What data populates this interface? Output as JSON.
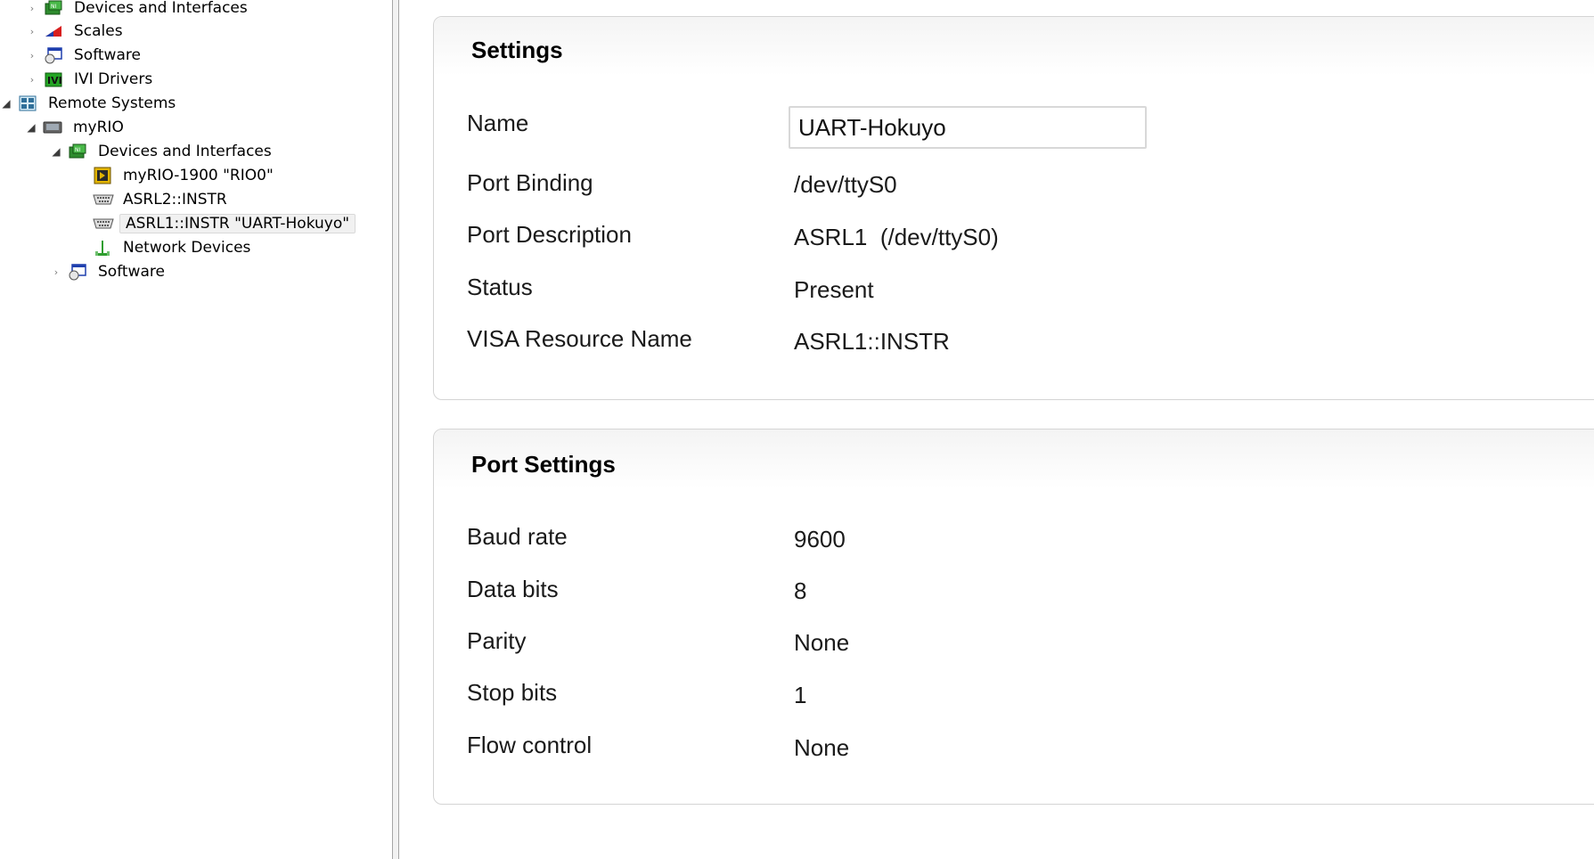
{
  "tree": {
    "items": [
      {
        "label": "Devices and Interfaces",
        "icon": "devices-interfaces-icon",
        "expander": "collapsed"
      },
      {
        "label": "Scales",
        "icon": "scales-icon",
        "expander": "collapsed"
      },
      {
        "label": "Software",
        "icon": "software-icon",
        "expander": "collapsed"
      },
      {
        "label": "IVI Drivers",
        "icon": "ivi-drivers-icon",
        "expander": "collapsed"
      },
      {
        "label": "Remote Systems",
        "icon": "remote-systems-icon",
        "expander": "expanded"
      },
      {
        "label": "myRIO",
        "icon": "computer-icon",
        "expander": "expanded"
      },
      {
        "label": "Devices and Interfaces",
        "icon": "devices-interfaces-icon",
        "expander": "expanded"
      },
      {
        "label": "myRIO-1900 \"RIO0\"",
        "icon": "daq-device-icon",
        "expander": "none"
      },
      {
        "label": "ASRL2::INSTR",
        "icon": "serial-port-icon",
        "expander": "none"
      },
      {
        "label": "ASRL1::INSTR \"UART-Hokuyo\"",
        "icon": "serial-port-icon",
        "expander": "none",
        "selected": true
      },
      {
        "label": "Network Devices",
        "icon": "network-devices-icon",
        "expander": "none"
      },
      {
        "label": "Software",
        "icon": "software-icon",
        "expander": "collapsed"
      }
    ]
  },
  "settings": {
    "title": "Settings",
    "name_label": "Name",
    "name_value": "UART-Hokuyo",
    "port_binding_label": "Port Binding",
    "port_binding_value": "/dev/ttyS0",
    "port_description_label": "Port Description",
    "port_description_value": "ASRL1  (/dev/ttyS0)",
    "status_label": "Status",
    "status_value": "Present",
    "visa_label": "VISA Resource Name",
    "visa_value": "ASRL1::INSTR"
  },
  "port_settings": {
    "title": "Port Settings",
    "baud_label": "Baud rate",
    "baud_value": "9600",
    "data_bits_label": "Data bits",
    "data_bits_value": "8",
    "parity_label": "Parity",
    "parity_value": "None",
    "stop_bits_label": "Stop bits",
    "stop_bits_value": "1",
    "flow_label": "Flow control",
    "flow_value": "None"
  },
  "colors": {
    "selection_bg": "#f1f1f1",
    "panel_border": "#d4d4d4",
    "splitter": "#a5a5a5"
  }
}
